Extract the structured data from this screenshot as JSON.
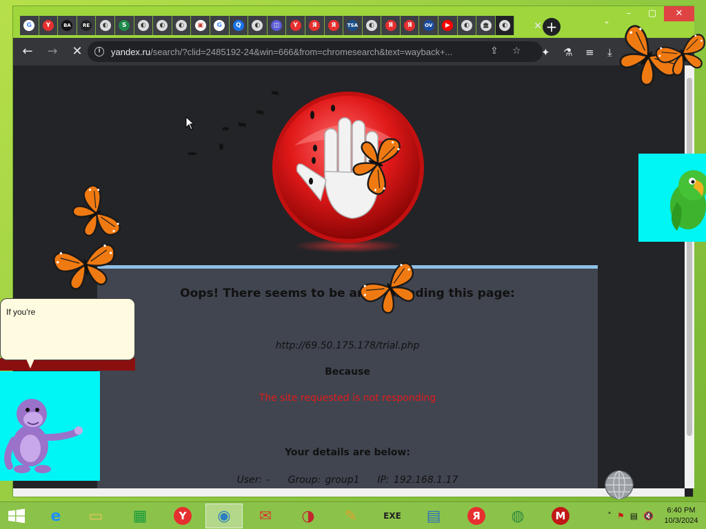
{
  "browser": {
    "tabs": [
      {
        "icon": "google-icon",
        "label": "G",
        "color": "#ffffff",
        "bg": "#ffffff",
        "fg": "#4285f4"
      },
      {
        "icon": "yandex-icon",
        "label": "Y",
        "bg": "#e62f2f",
        "fg": "#ffffff"
      },
      {
        "icon": "ba-icon",
        "label": "BA",
        "bg": "#111111",
        "fg": "#ffffff"
      },
      {
        "icon": "re-icon",
        "label": "RE",
        "bg": "#222222",
        "fg": "#ffffff"
      },
      {
        "icon": "globe-icon",
        "label": "◐",
        "bg": "#dddddd",
        "fg": "#333333"
      },
      {
        "icon": "s-icon",
        "label": "S",
        "bg": "#1e8a4c",
        "fg": "#ffffff"
      },
      {
        "icon": "globe-icon",
        "label": "◐",
        "bg": "#dddddd",
        "fg": "#333333"
      },
      {
        "icon": "globe-icon",
        "label": "◐",
        "bg": "#dddddd",
        "fg": "#333333"
      },
      {
        "icon": "globe-icon",
        "label": "◐",
        "bg": "#dddddd",
        "fg": "#333333"
      },
      {
        "icon": "photo-icon",
        "label": "▣",
        "bg": "#ffffff",
        "fg": "#c0392b"
      },
      {
        "icon": "google-icon",
        "label": "G",
        "bg": "#ffffff",
        "fg": "#4285f4"
      },
      {
        "icon": "q-icon",
        "label": "Q",
        "bg": "#1a73e8",
        "fg": "#ffffff"
      },
      {
        "icon": "globe-icon",
        "label": "◐",
        "bg": "#dddddd",
        "fg": "#333333"
      },
      {
        "icon": "app-icon",
        "label": "◫",
        "bg": "#5b5bd6",
        "fg": "#ffffff"
      },
      {
        "icon": "yandex-icon",
        "label": "Y",
        "bg": "#e62f2f",
        "fg": "#ffffff"
      },
      {
        "icon": "yandex-ya-icon",
        "label": "Я",
        "bg": "#e62f2f",
        "fg": "#ffffff"
      },
      {
        "icon": "yandex-ya-icon",
        "label": "Я",
        "bg": "#e62f2f",
        "fg": "#ffffff"
      },
      {
        "icon": "tsa-icon",
        "label": "TSA",
        "bg": "#1b4f8a",
        "fg": "#ffffff"
      },
      {
        "icon": "globe-icon",
        "label": "◐",
        "bg": "#dddddd",
        "fg": "#333333"
      },
      {
        "icon": "yandex-ya-icon",
        "label": "Я",
        "bg": "#e62f2f",
        "fg": "#ffffff"
      },
      {
        "icon": "yandex-ya-icon",
        "label": "Я",
        "bg": "#e62f2f",
        "fg": "#ffffff"
      },
      {
        "icon": "ov-icon",
        "label": "OV",
        "bg": "#1a4da1",
        "fg": "#ffffff"
      },
      {
        "icon": "youtube-icon",
        "label": "▶",
        "bg": "#ff0000",
        "fg": "#ffffff"
      },
      {
        "icon": "globe-icon",
        "label": "◐",
        "bg": "#dddddd",
        "fg": "#333333"
      },
      {
        "icon": "archive-icon",
        "label": "🏛",
        "bg": "#dddddd",
        "fg": "#333333"
      },
      {
        "icon": "globe-icon",
        "label": "◐",
        "bg": "#dddddd",
        "fg": "#333333",
        "active": true
      }
    ],
    "tab_close": "✕",
    "new_tab": "+",
    "window_controls": {
      "dropdown": "⌄",
      "minimize": "–",
      "maximize": "▢",
      "close": "✕"
    },
    "toolbar": {
      "back": "←",
      "forward": "→",
      "stop": "✕",
      "info": "i",
      "url_host": "yandex.ru",
      "url_path": "/search/?clid=2485192-24&win=666&from=chromesearch&text=wayback+...",
      "share": "⇪",
      "star": "☆",
      "extensions": "✦",
      "labs": "⚗",
      "media": "≡",
      "download": "⤓"
    }
  },
  "page": {
    "error_title": "Oops! There seems to be an issue loading this page:",
    "error_title_visible": "Oops! There seems to be ar     e loading this page:",
    "url": "http://69.50.175.178/trial.php",
    "because": "Because",
    "reason": "The site requested is not responding",
    "details_title": "Your details are below:",
    "details": "User: -    Group: group1    IP: 192.168.1.17"
  },
  "overlays": {
    "bubble_text": "If you're"
  },
  "taskbar": {
    "apps": [
      {
        "name": "internet-explorer-icon",
        "glyph": "e",
        "color": "#1e90ff"
      },
      {
        "name": "file-explorer-icon",
        "glyph": "▭",
        "color": "#e8c25a"
      },
      {
        "name": "store-icon",
        "glyph": "▦",
        "color": "#1a9c3d"
      },
      {
        "name": "yandex-browser-icon",
        "glyph": "Y",
        "color": "#e62f2f"
      },
      {
        "name": "chrome-icon",
        "glyph": "◉",
        "color": "#2d7fc1",
        "active": true
      },
      {
        "name": "mail-app-icon",
        "glyph": "✉",
        "color": "#d43a2f"
      },
      {
        "name": "red-circle-app-icon",
        "glyph": "◑",
        "color": "#c2262e"
      },
      {
        "name": "tools-app-icon",
        "glyph": "✎",
        "color": "#e0a030"
      },
      {
        "name": "youtube-exe-icon",
        "glyph": "EXE",
        "color": "#222222"
      },
      {
        "name": "news-app-icon",
        "glyph": "▤",
        "color": "#2f6fbf"
      },
      {
        "name": "yandex-ya-taskbar-icon",
        "glyph": "Я",
        "color": "#e62f2f"
      },
      {
        "name": "globe-download-icon",
        "glyph": "◍",
        "color": "#2f8a3f"
      },
      {
        "name": "mcafee-icon",
        "glyph": "M",
        "color": "#c01818"
      }
    ],
    "tray": {
      "chevron": "˄",
      "flag": "⚑",
      "network": "▤",
      "volume": "🔇"
    },
    "clock_time": "6:40 PM",
    "clock_date": "10/3/2024"
  }
}
